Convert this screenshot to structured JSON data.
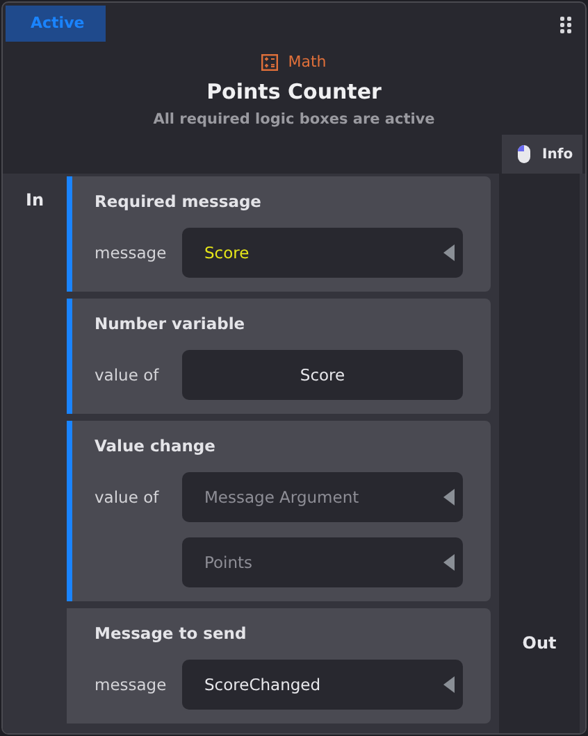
{
  "status_badge": "Active",
  "category": "Math",
  "title": "Points Counter",
  "subtitle": "All required logic boxes are active",
  "info_button": "Info",
  "in_label": "In",
  "out_label": "Out",
  "blocks": [
    {
      "title": "Required message",
      "active": true,
      "fields": [
        {
          "label": "message",
          "value": "Score",
          "kind": "dropdown",
          "highlighted": true
        }
      ]
    },
    {
      "title": "Number variable",
      "active": true,
      "fields": [
        {
          "label": "value of",
          "value": "Score",
          "kind": "text",
          "highlighted": false
        }
      ]
    },
    {
      "title": "Value change",
      "active": true,
      "fields": [
        {
          "label": "value of",
          "placeholder": "Message Argument",
          "kind": "dropdown"
        },
        {
          "placeholder": "Points",
          "kind": "dropdown"
        }
      ]
    },
    {
      "title": "Message to send",
      "active": false,
      "fields": [
        {
          "label": "message",
          "value": "ScoreChanged",
          "kind": "dropdown",
          "highlighted": false
        }
      ]
    }
  ]
}
